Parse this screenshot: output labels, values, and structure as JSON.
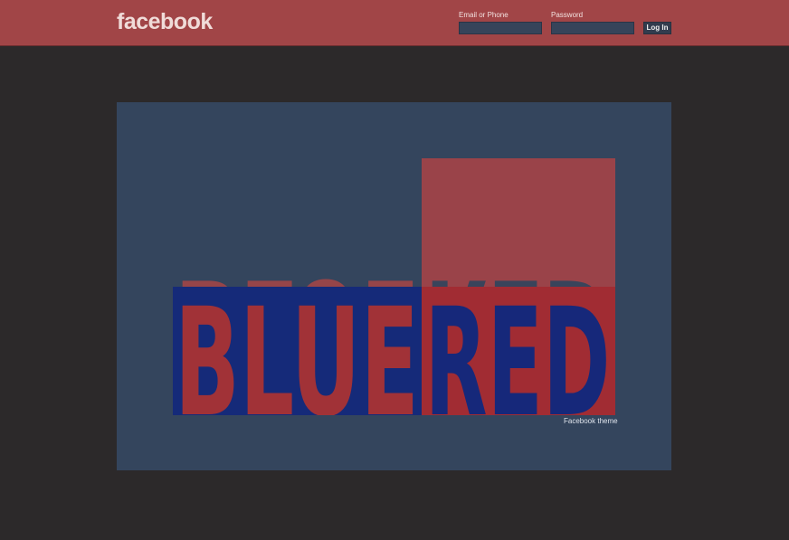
{
  "header": {
    "logo_text": "facebook",
    "email_label": "Email or Phone",
    "email_value": "",
    "password_label": "Password",
    "password_value": "",
    "login_label": "Log In"
  },
  "content": {
    "artwork_word_left": "BLUE",
    "artwork_word_right": "RED",
    "caption": "Facebook theme"
  },
  "colors": {
    "header_bg": "#a14547",
    "page_bg": "#2c292a",
    "panel_bg": "#34455d",
    "art_red": "#a13237",
    "art_blue": "#162a78"
  }
}
